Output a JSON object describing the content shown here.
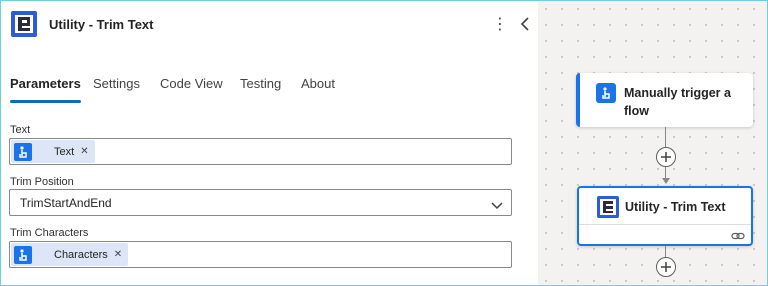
{
  "panel": {
    "title": "Utility - Trim Text",
    "more_icon": "more-vertical-icon",
    "collapse_icon": "chevron-left-icon"
  },
  "tabs": [
    {
      "label": "Parameters",
      "active": true
    },
    {
      "label": "Settings",
      "active": false
    },
    {
      "label": "Code View",
      "active": false
    },
    {
      "label": "Testing",
      "active": false
    },
    {
      "label": "About",
      "active": false
    }
  ],
  "fields": {
    "text": {
      "label": "Text",
      "token": "Text"
    },
    "trim_position": {
      "label": "Trim Position",
      "value": "TrimStartAndEnd"
    },
    "trim_characters": {
      "label": "Trim Characters",
      "token": "Characters"
    }
  },
  "canvas": {
    "trigger_card": {
      "title": "Manually trigger a flow"
    },
    "action_card": {
      "title": "Utility - Trim Text"
    }
  },
  "colors": {
    "accent": "#0f6cbd",
    "trigger_blue": "#1a73e8",
    "token_bg": "#dce6f7",
    "frame_border": "#69d3dc"
  }
}
